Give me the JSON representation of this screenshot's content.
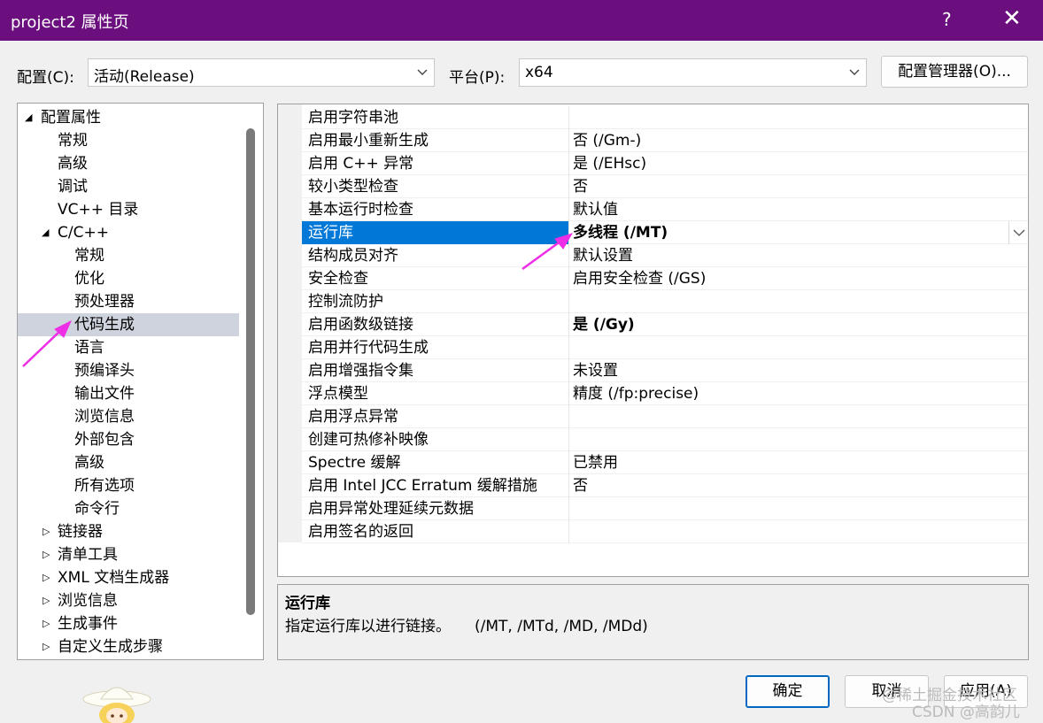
{
  "window": {
    "title": "project2 属性页",
    "help": "?",
    "close": "✕"
  },
  "toolbar": {
    "config_label": "配置(C):",
    "config_value": "活动(Release)",
    "platform_label": "平台(P):",
    "platform_value": "x64",
    "config_manager_label": "配置管理器(O)..."
  },
  "tree": {
    "items": [
      {
        "label": "配置属性",
        "expanded": true
      },
      {
        "label": "常规"
      },
      {
        "label": "高级"
      },
      {
        "label": "调试"
      },
      {
        "label": "VC++ 目录"
      },
      {
        "label": "C/C++",
        "expanded": true
      },
      {
        "label": "常规"
      },
      {
        "label": "优化"
      },
      {
        "label": "预处理器"
      },
      {
        "label": "代码生成",
        "selected": true
      },
      {
        "label": "语言"
      },
      {
        "label": "预编译头"
      },
      {
        "label": "输出文件"
      },
      {
        "label": "浏览信息"
      },
      {
        "label": "外部包含"
      },
      {
        "label": "高级"
      },
      {
        "label": "所有选项"
      },
      {
        "label": "命令行"
      },
      {
        "label": "链接器",
        "expanded": false
      },
      {
        "label": "清单工具",
        "expanded": false
      },
      {
        "label": "XML 文档生成器",
        "expanded": false
      },
      {
        "label": "浏览信息",
        "expanded": false
      },
      {
        "label": "生成事件",
        "expanded": false
      },
      {
        "label": "自定义生成步骤",
        "expanded": false
      }
    ]
  },
  "properties": [
    {
      "name": "启用字符串池",
      "value": ""
    },
    {
      "name": "启用最小重新生成",
      "value": "否 (/Gm-)"
    },
    {
      "name": "启用 C++ 异常",
      "value": "是 (/EHsc)"
    },
    {
      "name": "较小类型检查",
      "value": "否"
    },
    {
      "name": "基本运行时检查",
      "value": "默认值"
    },
    {
      "name": "运行库",
      "value": "多线程 (/MT)",
      "selected": true,
      "bold": true
    },
    {
      "name": "结构成员对齐",
      "value": "默认设置"
    },
    {
      "name": "安全检查",
      "value": "启用安全检查 (/GS)"
    },
    {
      "name": "控制流防护",
      "value": ""
    },
    {
      "name": "启用函数级链接",
      "value": "是 (/Gy)",
      "bold": true
    },
    {
      "name": "启用并行代码生成",
      "value": ""
    },
    {
      "name": "启用增强指令集",
      "value": "未设置"
    },
    {
      "name": "浮点模型",
      "value": "精度 (/fp:precise)"
    },
    {
      "name": "启用浮点异常",
      "value": ""
    },
    {
      "name": "创建可热修补映像",
      "value": ""
    },
    {
      "name": "Spectre 缓解",
      "value": "已禁用"
    },
    {
      "name": "启用 Intel JCC Erratum 缓解措施",
      "value": "否"
    },
    {
      "name": "启用异常处理延续元数据",
      "value": ""
    },
    {
      "name": "启用签名的返回",
      "value": ""
    }
  ],
  "description": {
    "title": "运行库",
    "text": "指定运行库以进行链接。     (/MT, /MTd, /MD, /MDd)"
  },
  "buttons": {
    "ok": "确定",
    "cancel": "取消",
    "apply": "应用(A)"
  },
  "watermark": {
    "line1": "@稀土掘金技术社区",
    "line2": "CSDN @高韵儿"
  },
  "colors": {
    "titlebar": "#6b0f7e",
    "selection": "#0078d7",
    "tree_selection": "#cfd3dd",
    "annotation_arrow": "#ee2ee6"
  }
}
